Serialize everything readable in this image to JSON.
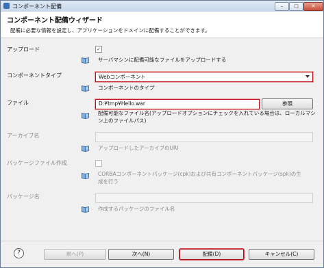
{
  "window": {
    "title": "コンポーネント配備",
    "controls": {
      "minimize": "–",
      "maximize": "□",
      "close": "✕"
    }
  },
  "header": {
    "title": "コンポーネント配備ウィザード",
    "description": "配備に必要な情報を設定し、アプリケーションをドメインに配備することができます。"
  },
  "form": {
    "upload": {
      "label": "アップロード",
      "checked": true,
      "check_mark": "✓",
      "description": "サーバマシンに配備可能なファイルをアップロードする"
    },
    "component_type": {
      "label": "コンポーネントタイプ",
      "value": "Webコンポーネント",
      "description": "コンポーネントのタイプ"
    },
    "file": {
      "label": "ファイル",
      "value": "D:¥tmp¥Hello.war",
      "browse_label": "参照",
      "description_line1": "配備可能なファイル名(アップロードオプションにチェックを入れている場合は、ローカルマシ",
      "description_line2": "ン上のファイルパス)"
    },
    "archive_name": {
      "label": "アーカイブ名",
      "value": "",
      "description": "アップロードしたアーカイブのURI"
    },
    "package_create": {
      "label": "パッケージファイル作成",
      "checked": false,
      "description_line1": "CORBAコンポーネントパッケージ(cpk)および共有コンポーネントパッケージ(spk)の生",
      "description_line2": "成を行う"
    },
    "package_name": {
      "label": "パッケージ名",
      "value": "",
      "description": "作成するパッケージのファイル名"
    }
  },
  "footer": {
    "help_icon": "?",
    "back_label": "前へ(P)",
    "next_label": "次へ(N)",
    "deploy_label": "配備(D)",
    "cancel_label": "キャンセル(C)"
  }
}
